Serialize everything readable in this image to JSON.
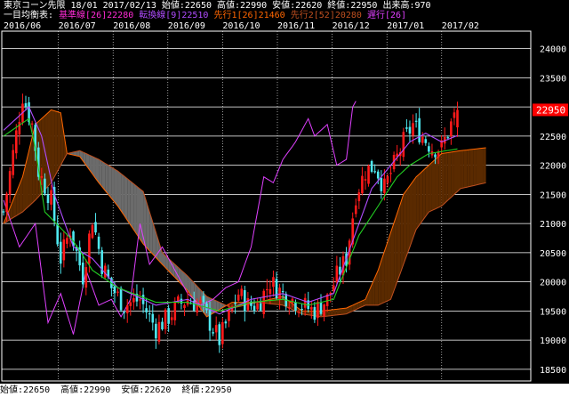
{
  "header": {
    "line1": "東京コーン先限  18/01  2017/02/13  始値:22650  高値:22990  安値:22620  終値:22950  出来高:970",
    "ichimoku_label": "一目均衡表:",
    "legend": [
      {
        "text": "基準線[26]22280",
        "color": "#ff2bd6"
      },
      {
        "text": "転換線[9]22510",
        "color": "#b04cff"
      },
      {
        "text": "先行1[26]21460",
        "color": "#ff6600"
      },
      {
        "text": "先行2[52]20280",
        "color": "#c05020"
      },
      {
        "text": "遅行[26]",
        "color": "#e040ff"
      }
    ]
  },
  "footer": {
    "open": "始値:22650",
    "high": "高値:22990",
    "low": "安値:22620",
    "close": "終値:22950"
  },
  "chart_data": {
    "type": "candlestick",
    "x_tick_labels": [
      "2016/06",
      "2016/07",
      "2016/08",
      "2016/09",
      "2016/10",
      "2016/11",
      "2016/12",
      "2017/01",
      "2017/02"
    ],
    "ylim": [
      18300,
      24300
    ],
    "y_ticks": [
      18500,
      19000,
      19500,
      20000,
      20500,
      21000,
      21500,
      22000,
      22500,
      23000,
      23500,
      24000
    ],
    "last_price": 22950,
    "colors": {
      "up": "#ff1a1a",
      "down": "#4ee8f0",
      "cloud_bear": "#6b6b6b",
      "cloud_bull": "#5a2a00",
      "grid": "#ffffff",
      "price_box": "#ff0000"
    },
    "anchors": [
      [
        0,
        21200
      ],
      [
        6,
        23200
      ],
      [
        9,
        22700
      ],
      [
        11,
        21900
      ],
      [
        15,
        21400
      ],
      [
        18,
        20400
      ],
      [
        21,
        20900
      ],
      [
        25,
        20100
      ],
      [
        28,
        21100
      ],
      [
        31,
        20300
      ],
      [
        34,
        19900
      ],
      [
        38,
        19600
      ],
      [
        43,
        19700
      ],
      [
        48,
        19200
      ],
      [
        52,
        19400
      ],
      [
        55,
        19600
      ],
      [
        58,
        19700
      ],
      [
        62,
        19600
      ],
      [
        66,
        19200
      ],
      [
        68,
        19000
      ],
      [
        71,
        19400
      ],
      [
        74,
        19800
      ],
      [
        77,
        19600
      ],
      [
        80,
        19600
      ],
      [
        84,
        20000
      ],
      [
        88,
        19800
      ],
      [
        91,
        19700
      ],
      [
        94,
        19600
      ],
      [
        98,
        19500
      ],
      [
        102,
        19700
      ],
      [
        105,
        20100
      ],
      [
        108,
        20400
      ],
      [
        111,
        21500
      ],
      [
        114,
        21900
      ],
      [
        117,
        22000
      ],
      [
        120,
        21600
      ],
      [
        123,
        22000
      ],
      [
        126,
        22400
      ],
      [
        129,
        22700
      ],
      [
        132,
        22500
      ],
      [
        135,
        22300
      ],
      [
        138,
        22300
      ],
      [
        141,
        22700
      ],
      [
        143,
        22950
      ]
    ],
    "kijun": [
      [
        0,
        22500
      ],
      [
        8,
        22800
      ],
      [
        10,
        22300
      ],
      [
        13,
        21200
      ],
      [
        22,
        20700
      ],
      [
        28,
        20200
      ],
      [
        36,
        19900
      ],
      [
        48,
        19650
      ],
      [
        58,
        19650
      ],
      [
        68,
        19500
      ],
      [
        78,
        19650
      ],
      [
        88,
        19700
      ],
      [
        96,
        19600
      ],
      [
        104,
        19700
      ],
      [
        112,
        20800
      ],
      [
        118,
        21300
      ],
      [
        124,
        21800
      ],
      [
        128,
        22000
      ],
      [
        134,
        22200
      ],
      [
        143,
        22280
      ]
    ],
    "tenkan": [
      [
        0,
        22600
      ],
      [
        8,
        23000
      ],
      [
        12,
        22500
      ],
      [
        16,
        21500
      ],
      [
        22,
        20600
      ],
      [
        28,
        20400
      ],
      [
        36,
        19900
      ],
      [
        48,
        19600
      ],
      [
        58,
        19700
      ],
      [
        68,
        19450
      ],
      [
        78,
        19700
      ],
      [
        88,
        19800
      ],
      [
        96,
        19650
      ],
      [
        104,
        19800
      ],
      [
        110,
        20700
      ],
      [
        116,
        21600
      ],
      [
        122,
        22000
      ],
      [
        128,
        22400
      ],
      [
        133,
        22550
      ],
      [
        138,
        22400
      ],
      [
        143,
        22510
      ]
    ],
    "chikou": [
      [
        0,
        21400
      ],
      [
        5,
        20600
      ],
      [
        10,
        21000
      ],
      [
        14,
        19300
      ],
      [
        18,
        19800
      ],
      [
        22,
        19100
      ],
      [
        26,
        20200
      ],
      [
        30,
        19600
      ],
      [
        34,
        19700
      ],
      [
        37,
        19400
      ],
      [
        40,
        19700
      ],
      [
        43,
        21000
      ],
      [
        46,
        20300
      ],
      [
        50,
        20600
      ],
      [
        54,
        20200
      ],
      [
        58,
        19800
      ],
      [
        62,
        19600
      ],
      [
        66,
        19700
      ],
      [
        70,
        19900
      ],
      [
        74,
        20000
      ],
      [
        78,
        20600
      ],
      [
        82,
        21800
      ],
      [
        85,
        21700
      ],
      [
        88,
        22100
      ],
      [
        92,
        22400
      ],
      [
        96,
        22800
      ],
      [
        98,
        22500
      ],
      [
        102,
        22700
      ],
      [
        105,
        22000
      ],
      [
        108,
        22100
      ],
      [
        110,
        23000
      ],
      [
        111,
        23100
      ]
    ],
    "span_a": [
      [
        0,
        21000
      ],
      [
        6,
        21800
      ],
      [
        10,
        22700
      ],
      [
        15,
        22950
      ],
      [
        18,
        22900
      ],
      [
        20,
        22200
      ],
      [
        24,
        22150
      ],
      [
        30,
        21700
      ],
      [
        36,
        21300
      ],
      [
        44,
        20650
      ],
      [
        50,
        20300
      ],
      [
        58,
        19850
      ],
      [
        64,
        19400
      ],
      [
        72,
        19650
      ],
      [
        80,
        19650
      ],
      [
        88,
        19750
      ],
      [
        94,
        19500
      ],
      [
        100,
        19500
      ],
      [
        108,
        19550
      ],
      [
        114,
        19700
      ],
      [
        118,
        20200
      ],
      [
        122,
        20850
      ],
      [
        126,
        21500
      ],
      [
        130,
        21800
      ],
      [
        134,
        22000
      ],
      [
        138,
        22200
      ],
      [
        144,
        22250
      ],
      [
        152,
        22300
      ]
    ],
    "span_b": [
      [
        0,
        21000
      ],
      [
        6,
        21200
      ],
      [
        10,
        21400
      ],
      [
        15,
        21700
      ],
      [
        18,
        22000
      ],
      [
        20,
        22200
      ],
      [
        24,
        22250
      ],
      [
        30,
        22100
      ],
      [
        36,
        21900
      ],
      [
        44,
        21550
      ],
      [
        50,
        20500
      ],
      [
        58,
        20100
      ],
      [
        64,
        19750
      ],
      [
        72,
        19550
      ],
      [
        80,
        19650
      ],
      [
        88,
        19600
      ],
      [
        94,
        19450
      ],
      [
        100,
        19400
      ],
      [
        108,
        19450
      ],
      [
        114,
        19600
      ],
      [
        118,
        19600
      ],
      [
        122,
        19700
      ],
      [
        126,
        20300
      ],
      [
        130,
        20900
      ],
      [
        134,
        21200
      ],
      [
        138,
        21300
      ],
      [
        144,
        21600
      ],
      [
        152,
        21700
      ]
    ]
  }
}
